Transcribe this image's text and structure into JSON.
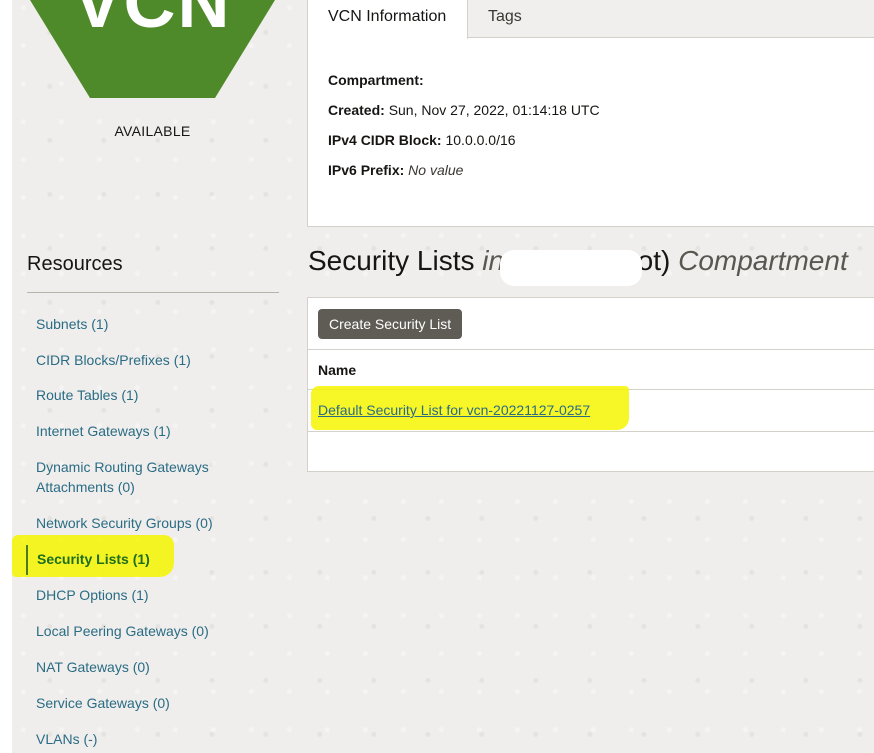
{
  "badge": {
    "text": "VCN",
    "status": "AVAILABLE",
    "color": "#4e8a2a"
  },
  "tabs": [
    {
      "label": "VCN Information",
      "active": true
    },
    {
      "label": "Tags",
      "active": false
    }
  ],
  "info": {
    "compartment_label": "Compartment:",
    "compartment_value": "",
    "created_label": "Created:",
    "created_value": "Sun, Nov 27, 2022, 01:14:18 UTC",
    "ipv4_label": "IPv4 CIDR Block:",
    "ipv4_value": "10.0.0.0/16",
    "ipv6_label": "IPv6 Prefix:",
    "ipv6_value": "No value"
  },
  "resources": {
    "title": "Resources",
    "items": [
      {
        "label": "Subnets (1)",
        "active": false
      },
      {
        "label": "CIDR Blocks/Prefixes (1)",
        "active": false
      },
      {
        "label": "Route Tables (1)",
        "active": false
      },
      {
        "label": "Internet Gateways (1)",
        "active": false
      },
      {
        "label": "Dynamic Routing Gateways Attachments (0)",
        "active": false
      },
      {
        "label": "Network Security Groups (0)",
        "active": false
      },
      {
        "label": "Security Lists (1)",
        "active": true
      },
      {
        "label": "DHCP Options (1)",
        "active": false
      },
      {
        "label": "Local Peering Gateways (0)",
        "active": false
      },
      {
        "label": "NAT Gateways (0)",
        "active": false
      },
      {
        "label": "Service Gateways (0)",
        "active": false
      },
      {
        "label": "VLANs (-)",
        "active": false
      }
    ]
  },
  "main": {
    "heading_main": "Security Lists",
    "heading_in": "in",
    "heading_root": "oot)",
    "heading_compartment": "Compartment",
    "create_button": "Create Security List",
    "column_name": "Name",
    "rows": [
      {
        "name": "Default Security List for vcn-20221127-0257"
      }
    ]
  },
  "colors": {
    "accent_green": "#4e8a2a",
    "link": "#2a6c84",
    "highlight": "#f6f500",
    "button": "#5f5b55"
  }
}
